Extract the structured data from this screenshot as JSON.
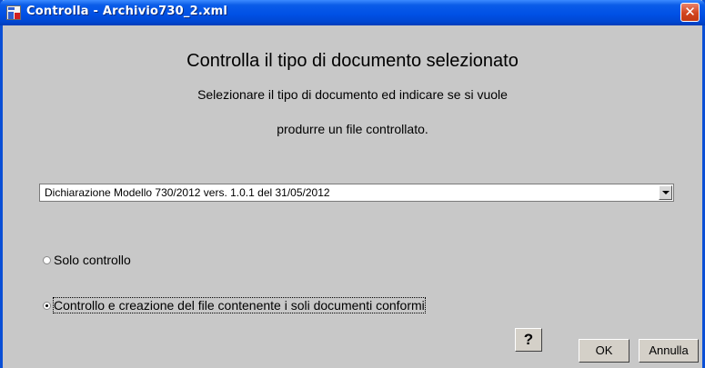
{
  "window": {
    "title": "Controlla - Archivio730_2.xml",
    "close_label": "✕"
  },
  "dialog": {
    "heading": "Controlla il tipo di documento selezionato",
    "instruction_line1": "Selezionare il tipo di documento ed indicare se si vuole",
    "instruction_line2": "produrre un file controllato."
  },
  "document_type": {
    "selected": "Dichiarazione Modello 730/2012  vers. 1.0.1 del 31/05/2012"
  },
  "options": {
    "solo_controllo": {
      "label": "Solo controllo",
      "checked": false
    },
    "controllo_creazione": {
      "label": "Controllo e creazione del file contenente i soli documenti conformi",
      "checked": true
    }
  },
  "buttons": {
    "help": "?",
    "ok": "OK",
    "cancel": "Annulla"
  }
}
